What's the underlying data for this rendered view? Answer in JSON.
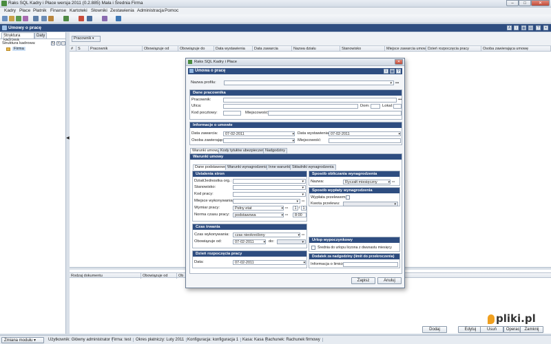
{
  "app": {
    "title": "Raks SQL Kadry i Płace wersja 2011 (0.2.885) Mała i Średnia Firma"
  },
  "menu": [
    "Kadry",
    "Płace",
    "Płatnik",
    "Finanse",
    "Kartoteki",
    "Słowniki",
    "Zestawienia",
    "Administracja",
    "Pomoc"
  ],
  "module_header": {
    "title": "Umowy o pracę"
  },
  "left_panel": {
    "tabs": [
      "Struktura kadrowa",
      "Daty"
    ],
    "tree_label": "Struktura kadrowa:",
    "tree_root": "Firma"
  },
  "filter": {
    "label": "Pracownik"
  },
  "grid": {
    "columns": [
      "#",
      "S",
      "Pracownik",
      "Obowiązuje od",
      "Obowiązuje do",
      "Data wystawienia",
      "Data zawarcia",
      "Nazwa działu",
      "Stanowisko",
      "Miejsce zawarcia umowy",
      "Dzień rozpoczęcia pracy",
      "Osoba zawierająca umowę"
    ]
  },
  "bottom_grid": {
    "columns": [
      "Rodzaj dokumentu",
      "Obowiązuje od",
      "Ob"
    ]
  },
  "buttons": {
    "dodaj": "Dodaj",
    "edytuj": "Edytuj",
    "usun": "Usuń",
    "operacje": "Operacje",
    "zamknij": "Zamknij"
  },
  "statusbar": {
    "module": "Zmiana modułu",
    "user": "Użytkownik: Główny administrator",
    "company": "Firma: test",
    "period": "Okres płatniczy: Luty 2011",
    "config": "Konfiguracja: konfiguracja 1",
    "cash": "Kasa: Kasa",
    "account": "Rachunek: Rachunek firmowy"
  },
  "logo": {
    "text": "pliki.pl"
  },
  "dialog": {
    "title": "Raks SQL Kadry i Płace",
    "header": "Umowa o pracę",
    "profile_label": "Nazwa profilu:",
    "employee_section": "Dane pracownika",
    "employee_label": "Pracownik:",
    "street_label": "Ulica:",
    "house_label": "Dom:",
    "flat_label": "Lokal:",
    "postcode_label": "Kod pocztowy:",
    "city_label": "Miejscowość:",
    "contract_section": "Informacje o umowie",
    "date_signed_label": "Data zawarcia:",
    "date_signed": "07-02-2011",
    "date_issued_label": "Data wystawienia:",
    "date_issued": "07-02-2011",
    "signer_label": "Osoba zawierająca:",
    "place_label": "Miejscowość:",
    "tabs": [
      "Warunki umowy",
      "Kody tytułów ubezpieczeń",
      "Nadgodziny"
    ],
    "conditions_header": "Warunki umowy",
    "subtabs": [
      "Dane podstawowe",
      "Warunki wynagrodzenia",
      "Inne warunki",
      "Składniki wynagrodzenia"
    ],
    "parties_section": "Ustalenia stron",
    "unit_label": "Dział/Jednostka org.:",
    "position_label": "Stanowisko:",
    "job_code_label": "Kod pracy:",
    "workplace_label": "Miejsce wykonywania:",
    "workload_label": "Wymiar pracy:",
    "workload_value": "Pełny etat",
    "ratio_num": "1",
    "ratio_den": "1",
    "norm_label": "Norma czasu pracy:",
    "norm_value": "podstawowa",
    "norm_hours": "8:00",
    "duration_section": "Czas trwania",
    "duration_label": "Czas wykonywania:",
    "duration_value": "czas nieokreślony",
    "valid_from_label": "Obowiązuje od:",
    "valid_from": "07-02-2011",
    "valid_to_label": "do:",
    "start_section": "Dzień rozpoczęcia pracy",
    "start_date_label": "Data:",
    "start_date": "07-02-2011",
    "salary_calc_section": "Sposób obliczania wynagrodzenia",
    "salary_name_label": "Nazwa:",
    "salary_name_value": "Ryczałt miesięczny",
    "payout_section": "Sposób wypłaty wynagrodzenia",
    "transfer_label": "Wypłata przelewem:",
    "transfer_amount_label": "Kwota przelewu:",
    "leave_section": "Urlop wypoczynkowy",
    "leave_check_label": "Średnia do urlopu liczona z dwunastu miesięcy",
    "overtime_section": "Dodatek za nadgodziny (limit do przekroczenia)",
    "limit_label": "Informacja o limicie:",
    "save_button": "Zapisz",
    "cancel_button": "Anuluj"
  }
}
